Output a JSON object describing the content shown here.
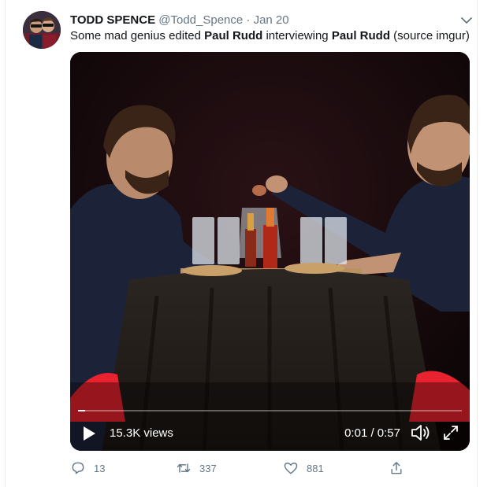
{
  "tweet": {
    "author_name": "TODD SPENCE",
    "handle": "@Todd_Spence",
    "separator": "·",
    "date": "Jan 20",
    "text": {
      "part1": "Some mad genius edited ",
      "bold1": "Paul Rudd",
      "part2": " interviewing ",
      "bold2": "Paul Rudd",
      "part3": " (source imgur)"
    }
  },
  "video": {
    "views": "15.3K views",
    "time": "0:01 / 0:57",
    "progress": 0.018
  },
  "actions": {
    "replies": "13",
    "retweets": "337",
    "likes": "881"
  },
  "icons": {
    "caret": "chevron-down-icon",
    "play": "play-icon",
    "volume": "volume-icon",
    "fullscreen": "fullscreen-icon",
    "reply": "reply-icon",
    "retweet": "retweet-icon",
    "like": "heart-icon",
    "share": "share-icon"
  },
  "colors": {
    "text": "#14171a",
    "secondary": "#657786",
    "border": "#e6ecf0"
  }
}
